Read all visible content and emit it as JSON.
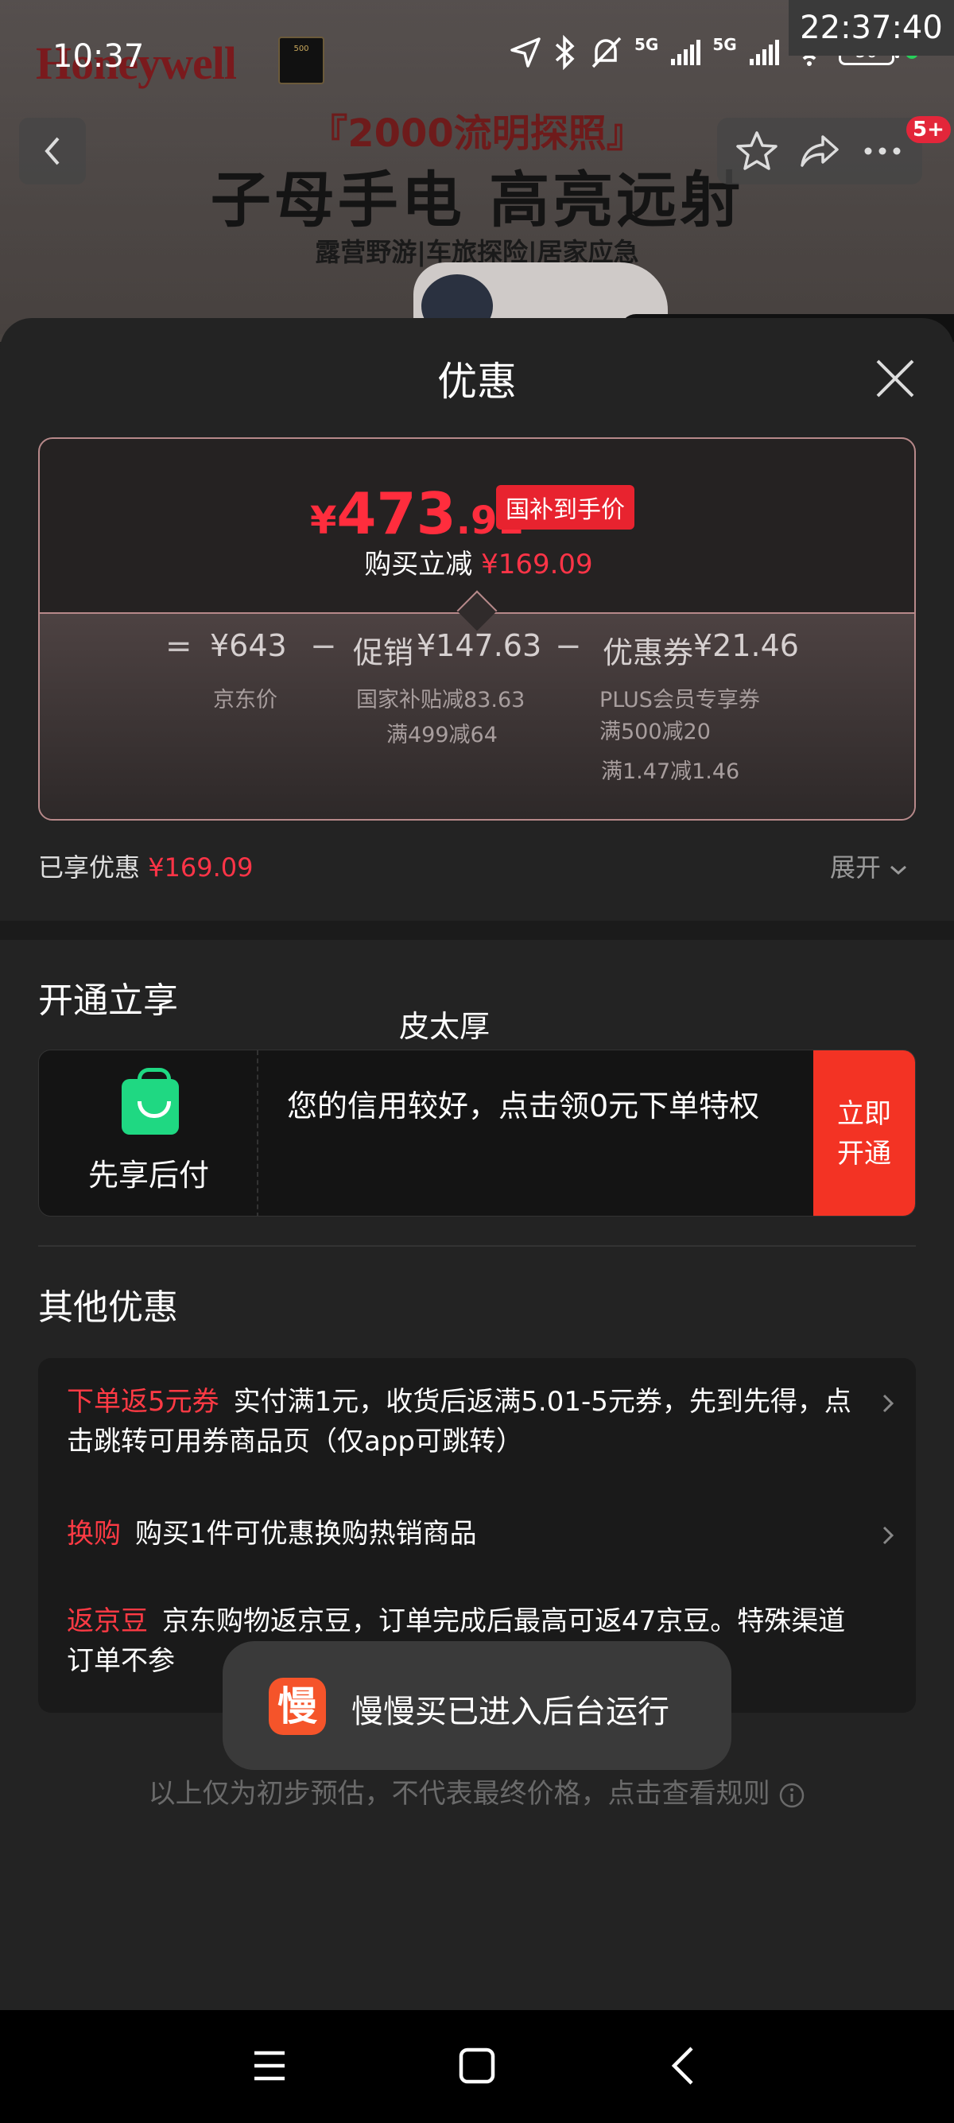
{
  "status_bar": {
    "time": "10:37",
    "clock": "22:37:40",
    "network": "5G",
    "network2": "5G",
    "battery": "50"
  },
  "background_page": {
    "brand": "Honeywell",
    "banner_subtitle": "『2000流明探照』",
    "banner_title": "子母手电 高亮远射",
    "banner_tags": "露营野游|车旅探险|居家应急",
    "notification_badge": "5+"
  },
  "sheet": {
    "title": "优惠",
    "price": {
      "symbol": "¥",
      "integer": "473",
      "decimal": ".91",
      "badge": "国补到手价",
      "reduce_label": "购买立减",
      "reduce_amount": "¥169.09"
    },
    "breakdown": {
      "eq": "=",
      "minus1": "−",
      "minus2": "−",
      "jd_price": "¥643",
      "jd_price_label": "京东价",
      "promo_label": "促销",
      "promo_value": "¥147.63",
      "promo_note1": "国家补贴减83.63",
      "promo_note2": "满499减64",
      "coupon_label": "优惠券",
      "coupon_value": "¥21.46",
      "coupon_note1": "PLUS会员专享券",
      "coupon_note2": "满500减20",
      "coupon_note3": "满1.47减1.46"
    },
    "enjoyed_label": "已享优惠",
    "enjoyed_amount": "¥169.09",
    "expand_label": "展开"
  },
  "open_section": {
    "title": "开通立享",
    "overlay_text": "皮太厚",
    "pay_name": "先享后付",
    "pay_desc": "您的信用较好，点击领0元下单特权",
    "pay_button_line1": "立即",
    "pay_button_line2": "开通"
  },
  "other_offers": {
    "title": "其他优惠",
    "items": [
      {
        "tag": "下单返5元券",
        "text": "实付满1元，收货后返满5.01-5元券，先到先得，点击跳转可用券商品页（仅app可跳转）"
      },
      {
        "tag": "换购",
        "text": "购买1件可优惠换购热销商品"
      },
      {
        "tag": "返京豆",
        "text": "京东购物返京豆，订单完成后最高可返47京豆。特殊渠道订单不参"
      }
    ]
  },
  "toast": {
    "icon_char": "慢",
    "text": "慢慢买已进入后台运行"
  },
  "disclaimer": "以上仅为初步预估，不代表最终价格，点击查看规则"
}
